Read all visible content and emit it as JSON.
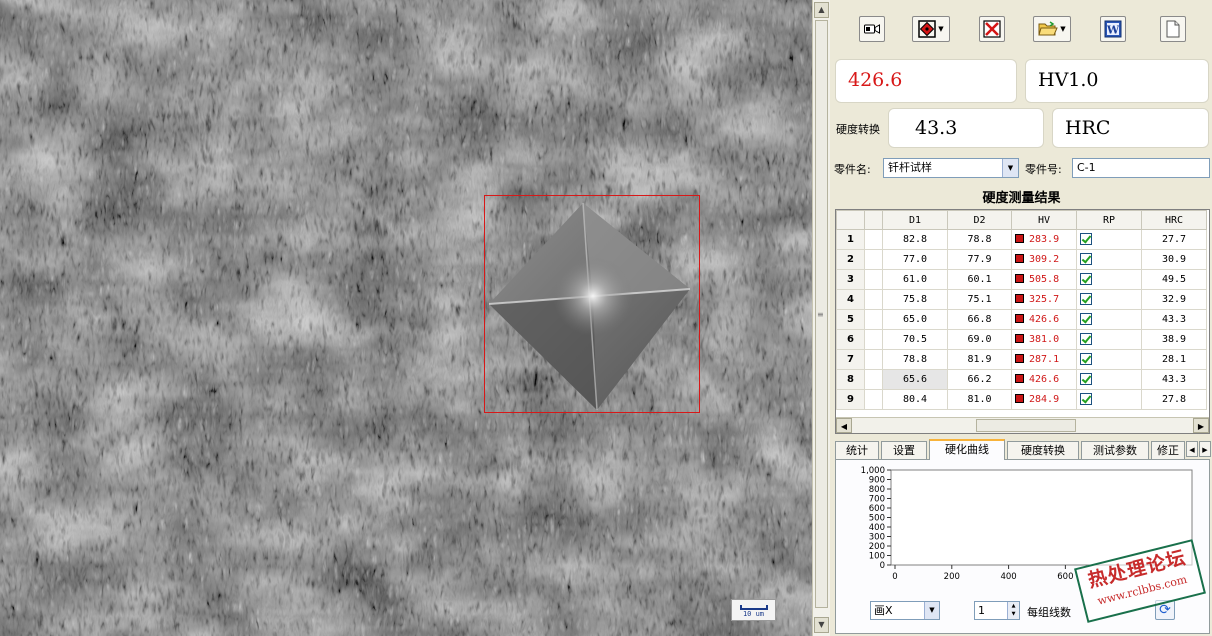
{
  "toolbar": {
    "buttons": [
      {
        "id": "camera",
        "icon": "video-camera-icon"
      },
      {
        "id": "measure-mode",
        "icon": "diamond-indent-icon",
        "dropdown": true
      },
      {
        "id": "delete",
        "icon": "red-x-icon"
      },
      {
        "id": "open",
        "icon": "folder-open-icon",
        "dropdown": true
      },
      {
        "id": "word-export",
        "icon": "word-doc-icon",
        "text": "W"
      },
      {
        "id": "new",
        "icon": "blank-page-icon"
      }
    ]
  },
  "readout": {
    "hardness_value": "426.6",
    "hardness_value_color": "#d81818",
    "scale": "HV1.0",
    "conversion_label": "硬度转换",
    "converted_value": "43.3",
    "converted_scale": "HRC"
  },
  "part": {
    "name_label": "零件名:",
    "name_value": "钎杆试样",
    "number_label": "零件号:",
    "number_value": "C-1"
  },
  "results": {
    "title": "硬度测量结果",
    "columns": [
      "D1",
      "D2",
      "HV",
      "RP",
      "HRC"
    ],
    "rows": [
      {
        "n": "1",
        "d1": "82.8",
        "d2": "78.8",
        "hv": "283.9",
        "hrc": "27.7"
      },
      {
        "n": "2",
        "d1": "77.0",
        "d2": "77.9",
        "hv": "309.2",
        "hrc": "30.9"
      },
      {
        "n": "3",
        "d1": "61.0",
        "d2": "60.1",
        "hv": "505.8",
        "hrc": "49.5"
      },
      {
        "n": "4",
        "d1": "75.8",
        "d2": "75.1",
        "hv": "325.7",
        "hrc": "32.9"
      },
      {
        "n": "5",
        "d1": "65.0",
        "d2": "66.8",
        "hv": "426.6",
        "hrc": "43.3"
      },
      {
        "n": "6",
        "d1": "70.5",
        "d2": "69.0",
        "hv": "381.0",
        "hrc": "38.9"
      },
      {
        "n": "7",
        "d1": "78.8",
        "d2": "81.9",
        "hv": "287.1",
        "hrc": "28.1"
      },
      {
        "n": "8",
        "d1": "65.6",
        "d2": "66.2",
        "hv": "426.6",
        "hrc": "43.3"
      },
      {
        "n": "9",
        "d1": "80.4",
        "d2": "81.0",
        "hv": "284.9",
        "hrc": "27.8"
      }
    ]
  },
  "tabs": [
    {
      "label": "统计",
      "active": false
    },
    {
      "label": "设置",
      "active": false
    },
    {
      "label": "硬化曲线",
      "active": true
    },
    {
      "label": "硬度转换",
      "active": false
    },
    {
      "label": "测试参数",
      "active": false
    },
    {
      "label": "修正",
      "active": false
    }
  ],
  "curve": {
    "yticks": [
      "1,000",
      "900",
      "800",
      "700",
      "600",
      "500",
      "400",
      "300",
      "200",
      "100",
      "0"
    ],
    "xticks": [
      "0",
      "200",
      "400",
      "600"
    ]
  },
  "controls": {
    "plot_mode": "画X",
    "lines_per_group": "1",
    "lines_per_group_label": "每组线数"
  },
  "scalebar": {
    "label": "10 um"
  },
  "watermark": {
    "line1": "热处理论坛",
    "line2": "www.rclbbs.com"
  }
}
